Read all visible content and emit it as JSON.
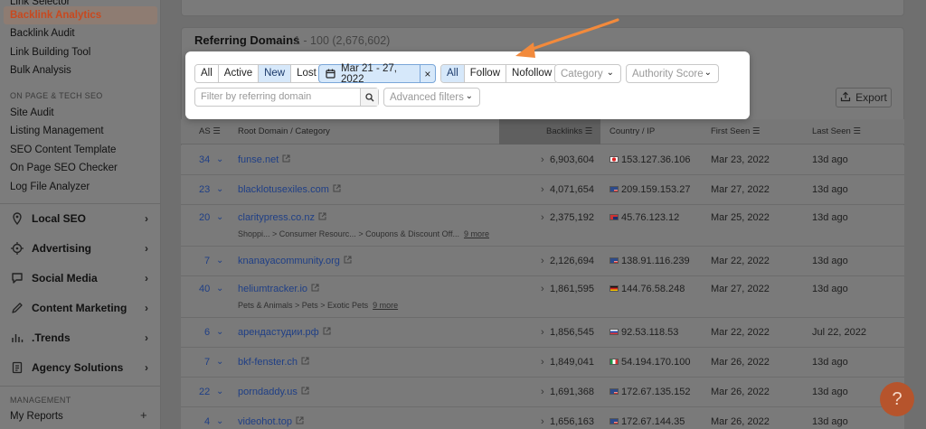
{
  "sidebar": {
    "top_partial": "Link Selector",
    "items_top": [
      "Backlink Analytics",
      "Backlink Audit",
      "Link Building Tool",
      "Bulk Analysis"
    ],
    "section1": "ON PAGE & TECH SEO",
    "items_mid": [
      "Site Audit",
      "Listing Management",
      "SEO Content Template",
      "On Page SEO Checker",
      "Log File Analyzer"
    ],
    "groups": [
      "Local SEO",
      "Advertising",
      "Social Media",
      "Content Marketing",
      ".Trends",
      "Agency Solutions"
    ],
    "section2": "MANAGEMENT",
    "my_reports": "My Reports",
    "plus": "+"
  },
  "card": {
    "title": "Referring Domains",
    "count": "1 - 100 (2,676,602)",
    "export": "Export"
  },
  "filters": {
    "status": [
      "All",
      "Active",
      "New",
      "Lost"
    ],
    "status_selected": "New",
    "date": "Mar 21 - 27, 2022",
    "date_clear": "×",
    "follow": [
      "All",
      "Follow",
      "Nofollow"
    ],
    "category_placeholder": "Category",
    "authority_placeholder": "Authority Score",
    "search_placeholder": "Filter by referring domain",
    "advanced": "Advanced filters"
  },
  "table": {
    "headers": {
      "as": "AS",
      "domain": "Root Domain / Category",
      "backlinks": "Backlinks",
      "country": "Country / IP",
      "first": "First Seen",
      "last": "Last Seen"
    },
    "rows": [
      {
        "as": "34",
        "domain": "funse.net",
        "cat": "",
        "more": "",
        "backlinks": "6,903,604",
        "flag": "jp",
        "ip": "153.127.36.106",
        "first": "Mar 23, 2022",
        "last": "13d ago"
      },
      {
        "as": "23",
        "domain": "blacklotusexiles.com",
        "cat": "",
        "more": "",
        "backlinks": "4,071,654",
        "flag": "us",
        "ip": "209.159.153.27",
        "first": "Mar 27, 2022",
        "last": "13d ago"
      },
      {
        "as": "20",
        "domain": "claritypress.co.nz",
        "cat": "Shoppi... > Consumer Resourc... > Coupons & Discount Off...",
        "more": "9 more",
        "backlinks": "2,375,192",
        "flag": "au",
        "ip": "45.76.123.12",
        "first": "Mar 25, 2022",
        "last": "13d ago"
      },
      {
        "as": "7",
        "domain": "knanayacommunity.org",
        "cat": "",
        "more": "",
        "backlinks": "2,126,694",
        "flag": "us",
        "ip": "138.91.116.239",
        "first": "Mar 22, 2022",
        "last": "13d ago"
      },
      {
        "as": "40",
        "domain": "heliumtracker.io",
        "cat": "Pets & Animals > Pets > Exotic Pets",
        "more": "9 more",
        "backlinks": "1,861,595",
        "flag": "de",
        "ip": "144.76.58.248",
        "first": "Mar 27, 2022",
        "last": "13d ago"
      },
      {
        "as": "6",
        "domain": "арендастудии.рф",
        "cat": "",
        "more": "",
        "backlinks": "1,856,545",
        "flag": "ru",
        "ip": "92.53.118.53",
        "first": "Mar 22, 2022",
        "last": "Jul 22, 2022"
      },
      {
        "as": "7",
        "domain": "bkf-fenster.ch",
        "cat": "",
        "more": "",
        "backlinks": "1,849,041",
        "flag": "it",
        "ip": "54.194.170.100",
        "first": "Mar 26, 2022",
        "last": "13d ago"
      },
      {
        "as": "22",
        "domain": "porndaddy.us",
        "cat": "",
        "more": "",
        "backlinks": "1,691,368",
        "flag": "us",
        "ip": "172.67.135.152",
        "first": "Mar 26, 2022",
        "last": "13d ago"
      },
      {
        "as": "4",
        "domain": "videohot.top",
        "cat": "",
        "more": "",
        "backlinks": "1,656,163",
        "flag": "us",
        "ip": "172.67.144.35",
        "first": "Mar 26, 2022",
        "last": "13d ago"
      }
    ]
  },
  "help_label": "?",
  "colors": {
    "accent": "#f28a3c",
    "link": "#2b5fb8",
    "selected": "#d6e8fa"
  }
}
